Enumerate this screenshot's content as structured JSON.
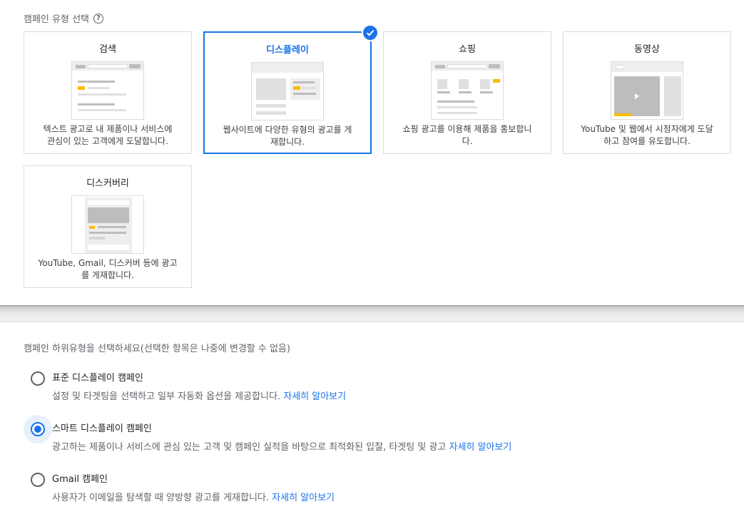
{
  "campaign_type": {
    "title": "캠페인 유형 선택",
    "help_icon": "help-circle-icon",
    "cards": [
      {
        "id": "search",
        "title": "검색",
        "desc1": "텍스트 광고로 내 제품이나 서비스에",
        "desc2": "관심이 있는 고객에게 도달합니다.",
        "selected": false
      },
      {
        "id": "display",
        "title": "디스플레이",
        "desc1": "웹사이트에 다양한 유형의 광고를 게",
        "desc2": "재합니다.",
        "selected": true
      },
      {
        "id": "shopping",
        "title": "쇼핑",
        "desc1": "쇼핑 광고를 이용해 제품을 홍보합니",
        "desc2": "다.",
        "selected": false
      },
      {
        "id": "video",
        "title": "동영상",
        "desc1": "YouTube 및 웹에서 시청자에게 도달",
        "desc2": "하고 참여를 유도합니다.",
        "selected": false
      },
      {
        "id": "discovery",
        "title": "디스커버리",
        "desc1": "YouTube, Gmail, 디스커버 등에 광고",
        "desc2": "를 게재합니다.",
        "selected": false
      }
    ]
  },
  "subtype": {
    "title": "캠페인 하위유형을 선택하세요(선택한 항목은 나중에 변경할 수 없음)",
    "options": [
      {
        "label": "표준 디스플레이 캠페인",
        "desc": "설정 및 타겟팅을 선택하고 일부 자동화 옵션을 제공합니다.",
        "link": "자세히 알아보기",
        "selected": false
      },
      {
        "label": "스마트 디스플레이 캠페인",
        "desc": "광고하는 제품이나 서비스에 관심 있는 고객 및 캠페인 실적을 바탕으로 최적화된 입찰, 타겟팅 및 광고",
        "link": "자세히 알아보기",
        "selected": true
      },
      {
        "label": "Gmail 캠페인",
        "desc": "사용자가 이메일을 탐색할 때 양방향 광고를 게재합니다.",
        "link": "자세히 알아보기",
        "selected": false
      }
    ]
  },
  "colors": {
    "accent": "#1a73e8",
    "highlight": "#fbbc04",
    "border": "#dadce0"
  }
}
